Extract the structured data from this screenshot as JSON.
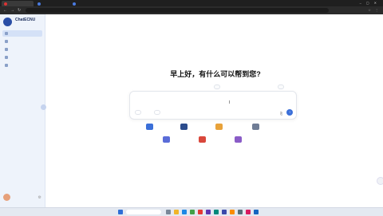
{
  "browser": {
    "tabs": [
      {
        "label": "",
        "active": true
      },
      {
        "label": "",
        "active": false
      },
      {
        "label": "",
        "active": false
      }
    ],
    "url": ""
  },
  "sidebar": {
    "brand": "ChatECNU",
    "brand_sub": "",
    "items": [
      {
        "label": "",
        "icon": "chat-icon",
        "active": true
      },
      {
        "label": "",
        "icon": "apps-icon",
        "active": false
      },
      {
        "label": "",
        "icon": "knowledge-icon",
        "active": false
      },
      {
        "label": "",
        "icon": "agent-icon",
        "active": false
      },
      {
        "label": "",
        "icon": "more-icon",
        "active": false
      }
    ],
    "history_title": "",
    "history_count": "",
    "history": [
      "",
      "",
      "",
      "",
      "",
      "",
      "",
      "",
      ""
    ],
    "user": {
      "name": "",
      "role": ""
    }
  },
  "main": {
    "greeting": "早上好，有什么可以帮到您?",
    "chips": [
      "",
      ""
    ],
    "input_placeholder": "",
    "tools": [
      "",
      ""
    ],
    "apps": [
      {
        "label": "",
        "color": "#3b6fd8"
      },
      {
        "label": "",
        "color": "#2b4c8c"
      },
      {
        "label": "",
        "color": "#e8a23a"
      },
      {
        "label": "",
        "color": "#6f7c95"
      },
      {
        "label": "",
        "color": "#5a6cd8"
      },
      {
        "label": "",
        "color": "#d9473b"
      },
      {
        "label": "",
        "color": "#8a5cc7"
      }
    ],
    "footer": ""
  },
  "taskbar": {
    "weather": "",
    "search_placeholder": "",
    "time": "",
    "date": ""
  }
}
